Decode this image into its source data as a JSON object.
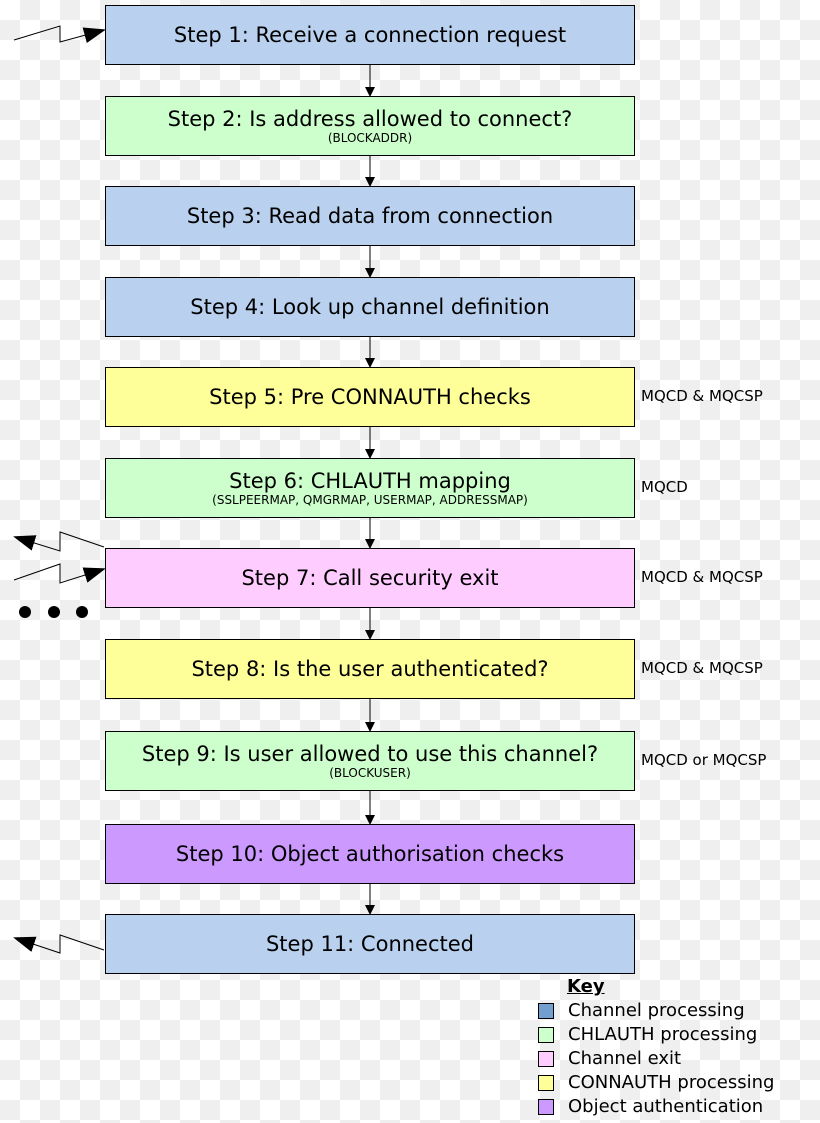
{
  "colors": {
    "channel": "#b9d1ee",
    "chlauth": "#ccffcc",
    "exit": "#ffccff",
    "connauth": "#ffff99",
    "object": "#cc99ff",
    "key_channel": "#729fcf"
  },
  "steps": [
    {
      "title": "Step 1: Receive a connection request",
      "sub": "",
      "side": "",
      "type": "channel"
    },
    {
      "title": "Step 2: Is address allowed to connect?",
      "sub": "(BLOCKADDR)",
      "side": "",
      "type": "chlauth"
    },
    {
      "title": "Step 3: Read data from connection",
      "sub": "",
      "side": "",
      "type": "channel"
    },
    {
      "title": "Step 4: Look up channel definition",
      "sub": "",
      "side": "",
      "type": "channel"
    },
    {
      "title": "Step 5: Pre CONNAUTH checks",
      "sub": "",
      "side": "MQCD & MQCSP",
      "type": "connauth"
    },
    {
      "title": "Step 6: CHLAUTH mapping",
      "sub": "(SSLPEERMAP, QMGRMAP, USERMAP, ADDRESSMAP)",
      "side": "MQCD",
      "type": "chlauth"
    },
    {
      "title": "Step 7: Call security exit",
      "sub": "",
      "side": "MQCD & MQCSP",
      "type": "exit"
    },
    {
      "title": "Step 8: Is the user authenticated?",
      "sub": "",
      "side": "MQCD & MQCSP",
      "type": "connauth"
    },
    {
      "title": "Step 9: Is user allowed to use this channel?",
      "sub": "(BLOCKUSER)",
      "side": "MQCD or MQCSP",
      "type": "chlauth"
    },
    {
      "title": "Step 10: Object authorisation checks",
      "sub": "",
      "side": "",
      "type": "object"
    },
    {
      "title": "Step 11: Connected",
      "sub": "",
      "side": "",
      "type": "channel"
    }
  ],
  "key": {
    "title": "Key",
    "items": [
      {
        "label": "Channel processing",
        "type": "key_channel"
      },
      {
        "label": "CHLAUTH processing",
        "type": "chlauth"
      },
      {
        "label": "Channel exit",
        "type": "exit"
      },
      {
        "label": "CONNAUTH processing",
        "type": "connauth"
      },
      {
        "label": "Object authentication",
        "type": "object"
      }
    ]
  }
}
